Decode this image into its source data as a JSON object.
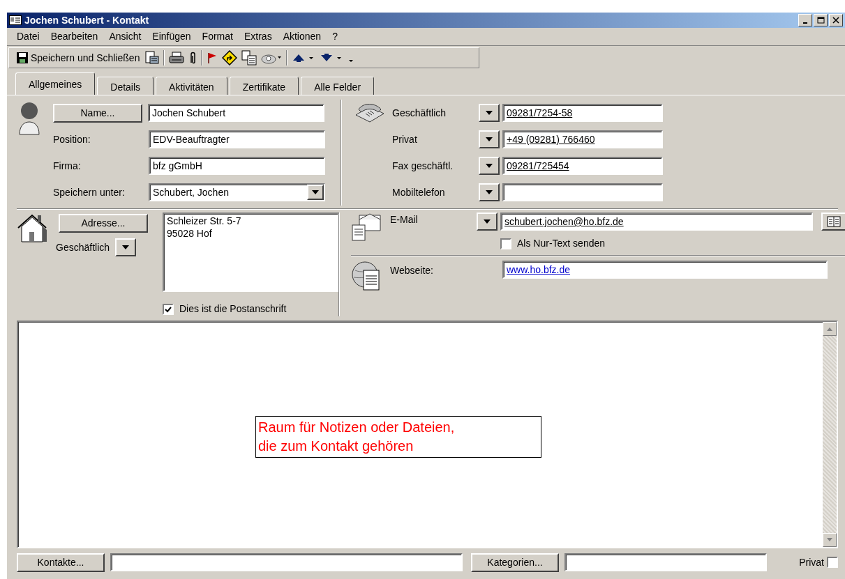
{
  "window": {
    "title": "Jochen Schubert - Kontakt"
  },
  "menu": [
    "Datei",
    "Bearbeiten",
    "Ansicht",
    "Einfügen",
    "Format",
    "Extras",
    "Aktionen",
    "?"
  ],
  "toolbar": [
    {
      "kind": "save",
      "label": "Speichern und Schließen"
    },
    {
      "kind": "form"
    },
    {
      "kind": "sep"
    },
    {
      "kind": "print"
    },
    {
      "kind": "clip"
    },
    {
      "kind": "sep"
    },
    {
      "kind": "flag"
    },
    {
      "kind": "sign"
    },
    {
      "kind": "doc"
    },
    {
      "kind": "dial"
    },
    {
      "kind": "sep"
    },
    {
      "kind": "up"
    },
    {
      "kind": "down"
    },
    {
      "kind": "more"
    }
  ],
  "tabs": [
    {
      "label": "Allgemeines",
      "selected": true
    },
    {
      "label": "Details",
      "selected": false
    },
    {
      "label": "Aktivitäten",
      "selected": false
    },
    {
      "label": "Zertifikate",
      "selected": false
    },
    {
      "label": "Alle Felder",
      "selected": false
    }
  ],
  "name_fields": [
    {
      "kind": "button",
      "label": "Name...",
      "value": "Jochen Schubert"
    },
    {
      "kind": "label",
      "label": "Position:",
      "value": "EDV-Beauftragter"
    },
    {
      "kind": "label",
      "label": "Firma:",
      "value": "bfz gGmbH"
    },
    {
      "kind": "combo",
      "label": "Speichern unter:",
      "value": "Schubert, Jochen"
    }
  ],
  "phones": [
    {
      "label": "Geschäftlich",
      "value": "09281/7254-58"
    },
    {
      "label": "Privat",
      "value": "+49 (09281) 766460"
    },
    {
      "label": "Fax geschäftl.",
      "value": "09281/725454"
    },
    {
      "label": "Mobiltelefon"
    }
  ],
  "address": {
    "button": "Adresse...",
    "type": "Geschäftlich",
    "lines": "Schleizer Str. 5-7\n95028 Hof",
    "mailing": {
      "label": "Dies ist die Postanschrift",
      "checked": true
    }
  },
  "email": {
    "label": "E-Mail",
    "value": "schubert.jochen@ho.bfz.de",
    "plain_text": {
      "label": "Als Nur-Text senden",
      "checked": false
    }
  },
  "web": {
    "label": "Webseite:",
    "value": "www.ho.bfz.de"
  },
  "annotation": [
    "Raum für Notizen oder Dateien,",
    "die zum Kontakt gehören"
  ],
  "footer": {
    "contacts_button": "Kontakte...",
    "categories_button": "Kategorien...",
    "private": {
      "label": "Privat",
      "checked": false
    }
  }
}
